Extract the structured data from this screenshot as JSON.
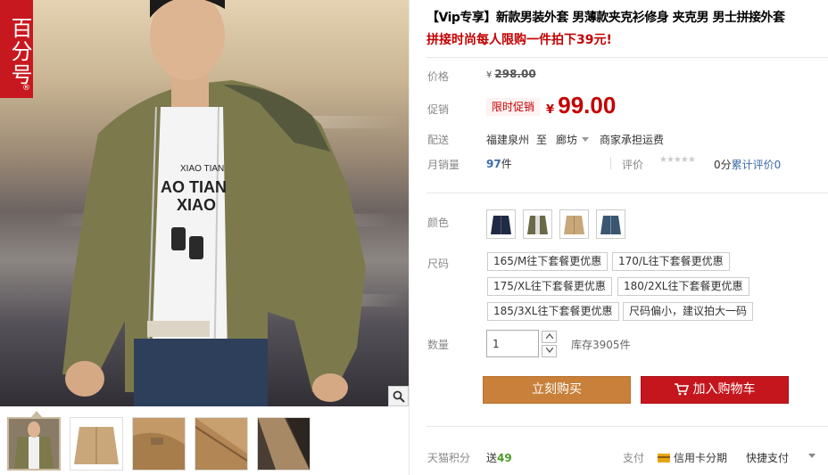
{
  "gallery": {
    "brand_logo_text": "百分号",
    "brand_registered": "®",
    "jacket_print_1": "XIAO TIAN",
    "jacket_print_2": "AO TIAN",
    "jacket_print_3": "XIAO",
    "thumbnail_count": 5,
    "active_thumbnail": 1
  },
  "product": {
    "title": "【Vip专享】新款男装外套 男薄款夹克衫修身 夹克男 男士拼接外套",
    "promo_line": "拼接时尚每人限购一件拍下39元!"
  },
  "price": {
    "label": "价格",
    "currency": "¥",
    "original": "298.00"
  },
  "promotion": {
    "label": "促销",
    "tag": "限时促销",
    "currency": "¥",
    "value": "99.00"
  },
  "delivery": {
    "label": "配送",
    "from": "福建泉州",
    "to_word": "至",
    "destination": "廊坊",
    "fee_note": "商家承担运费"
  },
  "sales": {
    "label": "月销量",
    "count": "97",
    "unit": "件",
    "rating_label": "评价",
    "stars": "★★★★★",
    "score": "0分",
    "reviews_link": "累计评价0"
  },
  "color": {
    "label": "颜色",
    "swatches": [
      {
        "name": "navy",
        "hex": "#1f2a44"
      },
      {
        "name": "army-green",
        "hex": "#6b6a48"
      },
      {
        "name": "khaki",
        "hex": "#c9a77a"
      },
      {
        "name": "denim-blue",
        "hex": "#3b5670"
      }
    ]
  },
  "size": {
    "label": "尺码",
    "options": [
      "165/M往下套餐更优惠",
      "170/L往下套餐更优惠",
      "175/XL往下套餐更优惠",
      "180/2XL往下套餐更优惠",
      "185/3XL往下套餐更优惠",
      "尺码偏小，建议拍大一码"
    ]
  },
  "quantity": {
    "label": "数量",
    "value": "1",
    "stock": "库存3905件"
  },
  "actions": {
    "buy_now": "立刻购买",
    "add_to_cart": "加入购物车"
  },
  "footer": {
    "points_label": "天猫积分",
    "points_prefix": "送",
    "points_value": "49",
    "pay_label": "支付",
    "credit_installment": "信用卡分期",
    "quick_pay": "快捷支付"
  },
  "colors": {
    "accent_red": "#c40000",
    "buy_orange": "#c8803a",
    "cart_red": "#c4161c",
    "link_blue": "#3c6aa8",
    "points_green": "#4b9b28"
  }
}
